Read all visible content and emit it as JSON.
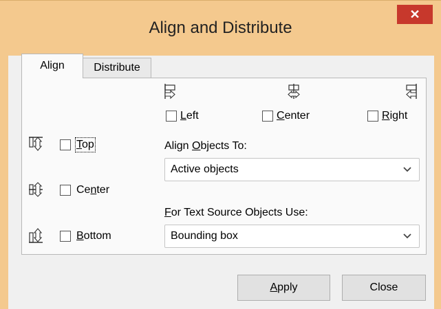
{
  "window": {
    "title": "Align and Distribute",
    "close_glyph": "✕"
  },
  "tabs": [
    {
      "label": "Align",
      "active": true
    },
    {
      "label": "Distribute",
      "active": false
    }
  ],
  "horizontal_align": {
    "options": [
      {
        "label_pre": "",
        "mnemonic": "L",
        "label_post": "eft",
        "icon": "align-left-icon",
        "checked": false
      },
      {
        "label_pre": "",
        "mnemonic": "C",
        "label_post": "enter",
        "icon": "align-center-horizontal-icon",
        "checked": false
      },
      {
        "label_pre": "",
        "mnemonic": "R",
        "label_post": "ight",
        "icon": "align-right-icon",
        "checked": false
      }
    ]
  },
  "vertical_align": {
    "options": [
      {
        "label_pre": "",
        "mnemonic": "T",
        "label_post": "op",
        "icon": "align-top-icon",
        "checked": false
      },
      {
        "label_pre": "Ce",
        "mnemonic": "n",
        "label_post": "ter",
        "icon": "align-center-vertical-icon",
        "checked": false
      },
      {
        "label_pre": "",
        "mnemonic": "B",
        "label_post": "ottom",
        "icon": "align-bottom-icon",
        "checked": false
      }
    ]
  },
  "align_objects_to": {
    "label_pre": "Align ",
    "mnemonic": "O",
    "label_post": "bjects To:",
    "selected": "Active objects"
  },
  "text_source": {
    "label_pre": "",
    "mnemonic": "F",
    "label_post": "or Text Source Objects Use:",
    "selected": "Bounding box"
  },
  "buttons": {
    "apply": {
      "mnemonic": "A",
      "label_post": "pply"
    },
    "close": {
      "label": "Close"
    }
  },
  "colors": {
    "titlebar": "#f4c98e",
    "close_button": "#c7382c",
    "dialog_bg": "#f0f0f0",
    "panel_bg": "#fafafa"
  }
}
